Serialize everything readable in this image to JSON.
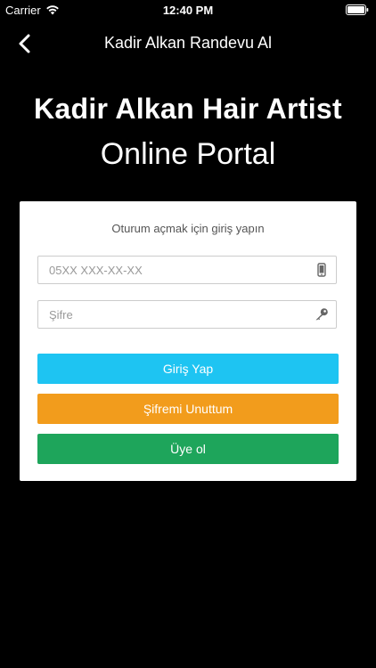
{
  "status_bar": {
    "carrier": "Carrier",
    "time": "12:40 PM"
  },
  "nav": {
    "title": "Kadir Alkan Randevu Al",
    "back_icon": "chevron-left-icon"
  },
  "header": {
    "title": "Kadir Alkan Hair Artist",
    "subtitle": "Online Portal"
  },
  "form": {
    "hint": "Oturum açmak için giriş yapın",
    "phone_placeholder": "05XX XXX-XX-XX",
    "phone_icon": "mobile-phone-icon",
    "password_placeholder": "Şifre",
    "password_icon": "key-icon",
    "login_label": "Giriş Yap",
    "forgot_label": "Şifremi Unuttum",
    "signup_label": "Üye ol"
  },
  "colors": {
    "background": "#000000",
    "card": "#ffffff",
    "login": "#1ec4f2",
    "forgot": "#f29c1c",
    "signup": "#1ea55b"
  }
}
